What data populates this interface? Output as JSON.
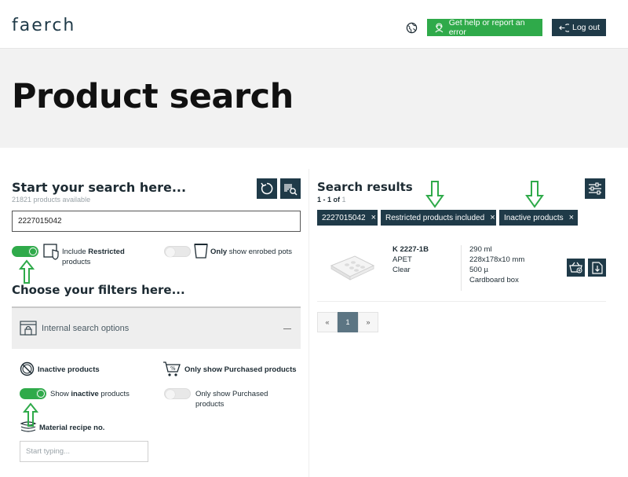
{
  "header": {
    "logo": "faerch",
    "help_button": "Get help or report an error",
    "logout_button": "Log out"
  },
  "hero": {
    "title": "Product search"
  },
  "left": {
    "title": "Start your search here...",
    "subtitle": "21821 products available",
    "search_value": "2227015042",
    "restricted_label_pre": "Include ",
    "restricted_label_bold": "Restricted",
    "restricted_label_post": "products",
    "enrobed_label_bold": "Only",
    "enrobed_label_post": " show enrobed pots",
    "filters_title": "Choose your filters here...",
    "accordion_label": "Internal search options",
    "inactive_section": "Inactive products",
    "inactive_toggle_pre": "Show ",
    "inactive_toggle_bold": "inactive",
    "inactive_toggle_post": " products",
    "purchased_section": "Only show Purchased products",
    "purchased_toggle": "Only show Purchased",
    "purchased_toggle_line2": "products",
    "recipe_section": "Material recipe no.",
    "recipe_placeholder": "Start typing..."
  },
  "toggles": {
    "restricted": true,
    "enrobed": false,
    "inactive": true,
    "purchased": false
  },
  "right": {
    "title": "Search results",
    "count_main": "1 - 1 of ",
    "count_total": "1",
    "chips": [
      "2227015042",
      "Restricted products included",
      "Inactive products"
    ],
    "chip_close": "×",
    "result": {
      "code": "K 2227-1B",
      "material": "APET",
      "color": "Clear",
      "volume": "290 ml",
      "dimensions": "228x178x10 mm",
      "thickness": "500 µ",
      "packaging": "Cardboard box"
    },
    "pager": {
      "prev": "«",
      "current": "1",
      "next": "»"
    }
  },
  "colors": {
    "brand_dark": "#1f3a48",
    "accent_green": "#2faa4a",
    "hero_bg": "#f2f2f2"
  }
}
